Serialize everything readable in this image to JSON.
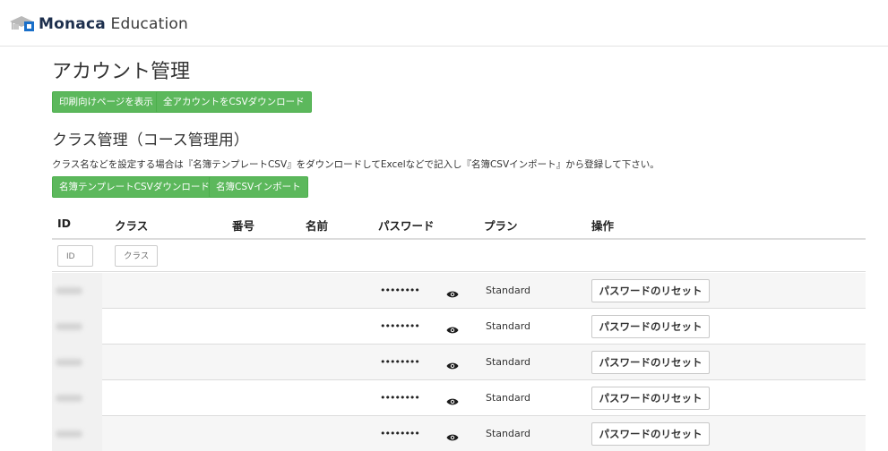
{
  "app": {
    "brand_bold": "Monaca",
    "brand_light": " Education"
  },
  "page": {
    "title": "アカウント管理",
    "print_button": "印刷向けページを表示",
    "download_all_button": "全アカウントをCSVダウンロード"
  },
  "class_section": {
    "title": "クラス管理（コース管理用）",
    "description": "クラス名などを設定する場合は『名簿テンプレートCSV』をダウンロードしてExcelなどで記入し『名簿CSVインポート』から登録して下さい。",
    "template_download_button": "名簿テンプレートCSVダウンロード",
    "import_button": "名簿CSVインポート"
  },
  "table": {
    "headers": {
      "id": "ID",
      "class": "クラス",
      "number": "番号",
      "name": "名前",
      "password": "パスワード",
      "plan": "プラン",
      "action": "操作"
    },
    "filters": {
      "id_placeholder": "ID",
      "class_placeholder": "クラス"
    },
    "rows": [
      {
        "password": "••••••••",
        "plan": "Standard",
        "action": "パスワードのリセット"
      },
      {
        "password": "••••••••",
        "plan": "Standard",
        "action": "パスワードのリセット"
      },
      {
        "password": "••••••••",
        "plan": "Standard",
        "action": "パスワードのリセット"
      },
      {
        "password": "••••••••",
        "plan": "Standard",
        "action": "パスワードのリセット"
      },
      {
        "password": "••••••••",
        "plan": "Standard",
        "action": "パスワードのリセット"
      }
    ]
  },
  "icons": {
    "logo": "graduation-cap-icon",
    "reveal": "eye-icon"
  },
  "colors": {
    "button_green": "#5cb85c",
    "brand_blue": "#1a6fc9"
  }
}
